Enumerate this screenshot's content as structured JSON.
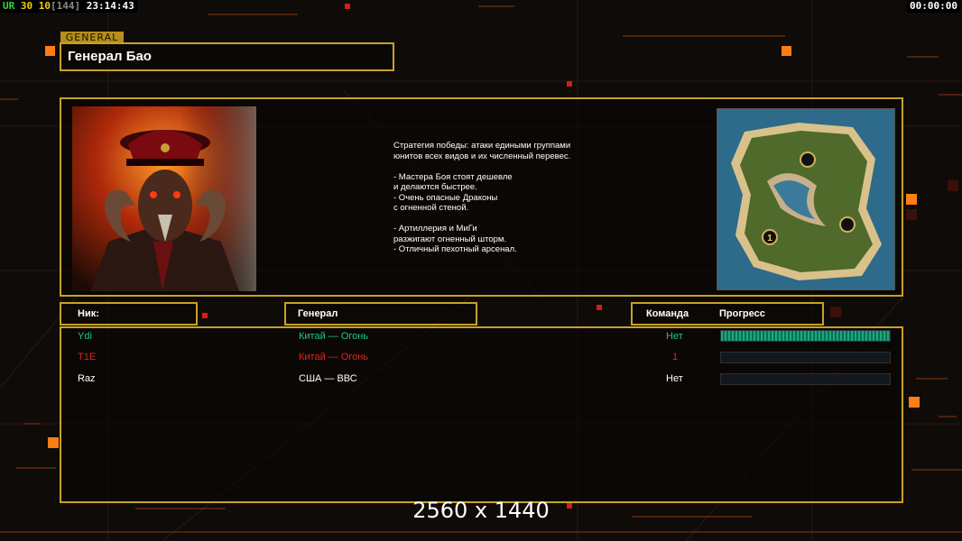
{
  "top_left": {
    "tag": "UR",
    "val1": "30",
    "val2": "10",
    "bracket": "[144]",
    "clock": "23:14:43"
  },
  "top_right": {
    "timer": "00:00:00"
  },
  "general": {
    "tag": "GENERAL",
    "name": "Генерал Бао"
  },
  "strategy_text": "Стратегия победы: атаки едиными группами\nюнитов всех видов и их численный перевес.\n\n- Мастера Боя стоят дешевле\nи делаются быстрее.\n- Очень опасные Драконы\nс огненной стеной.\n\n- Артиллерия и МиГи\nразжигают огненный шторм.\n- Отличный пехотный арсенал.",
  "map": {
    "marker": "1"
  },
  "columns": {
    "nick": "Ник:",
    "general": "Генерал",
    "team": "Команда",
    "progress": "Прогресс"
  },
  "players": [
    {
      "nick": "Ydi",
      "general": "Китай — Огонь",
      "team": "Нет",
      "progress": 1.0,
      "color": "#1fc78f"
    },
    {
      "nick": "T1E",
      "general": "Китай — Огонь",
      "team": "1",
      "progress": 0.0,
      "color": "#e0241d"
    },
    {
      "nick": "Raz",
      "general": "США — ВВС",
      "team": "Нет",
      "progress": 0.0,
      "color": "#ffffff"
    }
  ],
  "resolution": "2560 x 1440",
  "colors": {
    "accent": "#c8a224",
    "orange": "#ff8a1c",
    "green": "#1fc78f",
    "red": "#e0241d"
  }
}
